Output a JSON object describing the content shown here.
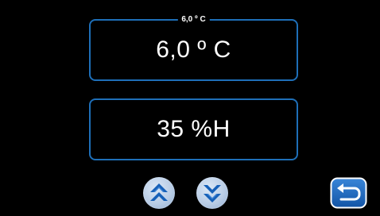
{
  "temperature_panel": {
    "caption": "6,0 º C",
    "value": "6,0 º C"
  },
  "humidity_panel": {
    "value": "35 %H"
  },
  "controls": {
    "up_icon": "double-chevron-up-icon",
    "down_icon": "double-chevron-down-icon",
    "back_icon": "return-arrow-icon"
  },
  "colors": {
    "background": "#000000",
    "panel_border": "#1e6fb8",
    "text": "#ffffff",
    "button_face": "#b9cde6",
    "icon_blue": "#1560b8"
  }
}
